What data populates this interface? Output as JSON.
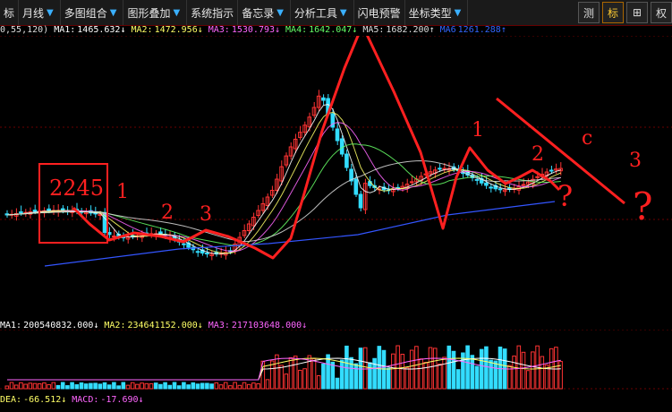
{
  "toolbar": {
    "items": [
      {
        "label": "标",
        "arrow": false
      },
      {
        "label": "月线",
        "arrow": true
      },
      {
        "label": "多图组合",
        "arrow": true
      },
      {
        "label": "图形叠加",
        "arrow": true
      },
      {
        "label": "系统指示",
        "arrow": false
      },
      {
        "label": "备忘录",
        "arrow": true
      },
      {
        "label": "分析工具",
        "arrow": true
      },
      {
        "label": "闪电预警",
        "arrow": false
      },
      {
        "label": "坐标类型",
        "arrow": true
      }
    ],
    "right_buttons": [
      {
        "label": "测",
        "active": false
      },
      {
        "label": "标",
        "active": true
      },
      {
        "label": "⊞",
        "active": false
      },
      {
        "label": "权",
        "active": false
      }
    ]
  },
  "price_ma": {
    "prefix": "0,55,120)",
    "items": [
      {
        "label": "MA1:",
        "value": "1465.632↓",
        "color": "#ffffff"
      },
      {
        "label": "MA2:",
        "value": "1472.956↓",
        "color": "#ffff66"
      },
      {
        "label": "MA3:",
        "value": "1530.793↓",
        "color": "#ff66ff"
      },
      {
        "label": "MA4:",
        "value": "1642.047↓",
        "color": "#66ff66"
      },
      {
        "label": "MA5:",
        "value": "1682.200↑",
        "color": "#dddddd"
      },
      {
        "label": "MA6",
        "value": "1261.288↑",
        "color": "#3366ff"
      }
    ]
  },
  "volume_ma": {
    "items": [
      {
        "label": "MA1:",
        "value": "200540832.000↓",
        "color": "#ffffff"
      },
      {
        "label": "MA2:",
        "value": "234641152.000↓",
        "color": "#ffff66"
      },
      {
        "label": "MA3:",
        "value": "217103648.000↓",
        "color": "#ff66ff"
      }
    ]
  },
  "macd": {
    "items": [
      {
        "label": "DEA:",
        "value": "-66.512↓",
        "color": "#ffff66"
      },
      {
        "label": "MACD:",
        "value": "-17.690↓",
        "color": "#ff66ff"
      }
    ]
  },
  "annotations": {
    "box_label": "2245",
    "wave_labels": [
      "1",
      "2",
      "3",
      "1",
      "2",
      "c",
      "3"
    ],
    "question_marks": [
      "?",
      "?"
    ]
  },
  "colors": {
    "up": "#ff3333",
    "down": "#33ddff",
    "annotation": "#ff2020",
    "grid": "#6a0000"
  }
}
